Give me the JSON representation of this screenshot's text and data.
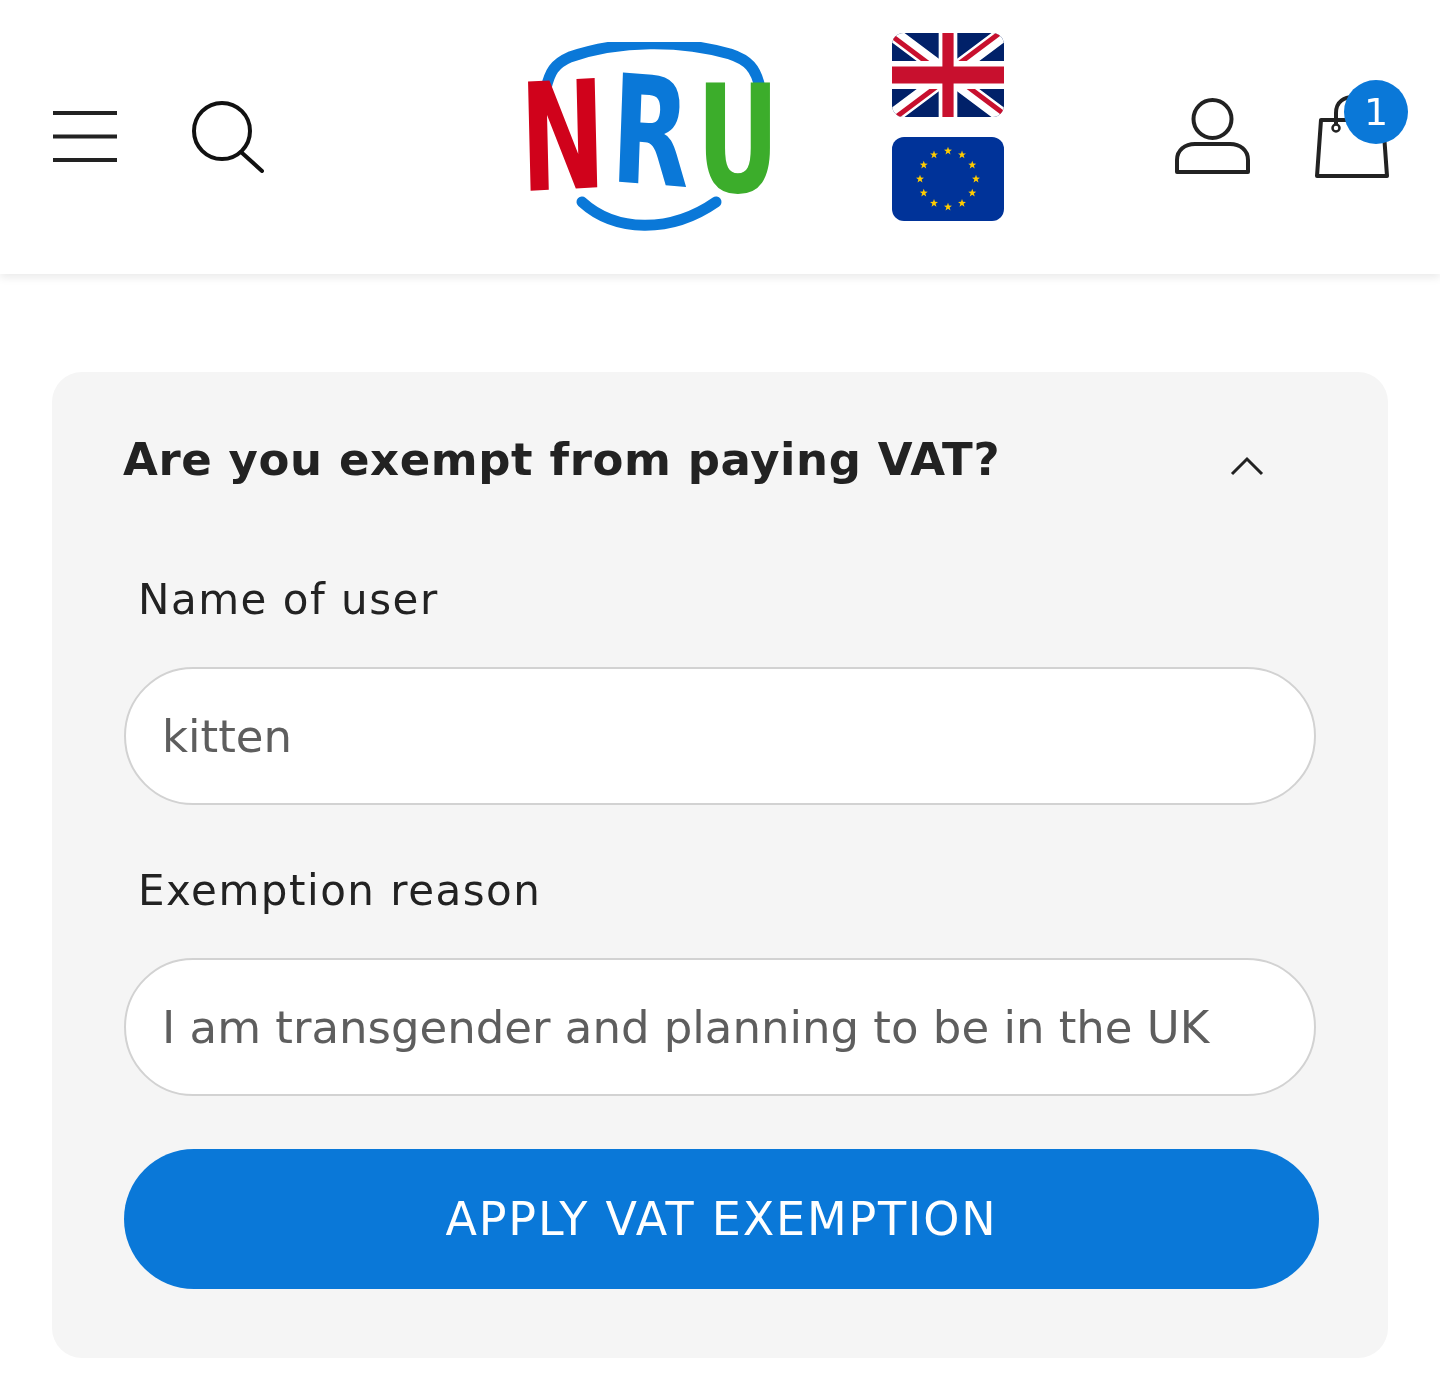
{
  "header": {
    "logo": {
      "letters": [
        {
          "text": "N",
          "color": "#d0021b"
        },
        {
          "text": "R",
          "color": "#0a78d8"
        },
        {
          "text": "U",
          "color": "#3cad2b"
        }
      ]
    },
    "cart": {
      "count": "1"
    }
  },
  "panel": {
    "title": "Are you exempt from paying VAT?",
    "expanded": true,
    "fields": [
      {
        "label": "Name of user",
        "value": "kitten"
      },
      {
        "label": "Exemption reason",
        "value": "I am transgender and planning to be in the UK"
      }
    ],
    "button": "APPLY VAT EXEMPTION"
  }
}
